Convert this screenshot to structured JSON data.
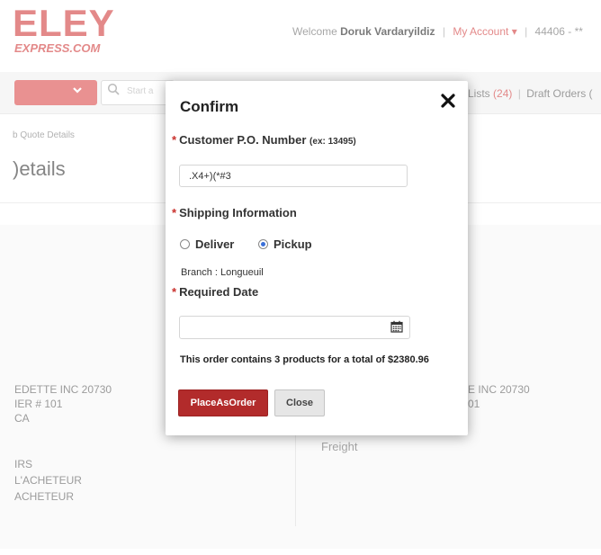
{
  "header": {
    "logo_main": "ELEY",
    "logo_sub": "EXPRESS.COM",
    "welcome_prefix": "Welcome",
    "user_name": "Doruk Vardaryildiz",
    "my_account_label": "My Account",
    "account_number": "44406 - **"
  },
  "navbar": {
    "search_placeholder": "Start a",
    "lists_label": "Lists",
    "lists_count": "(24)",
    "draft_orders_label": "Draft Orders ("
  },
  "page": {
    "breadcrumb": "b Quote Details",
    "title": ")etails",
    "left_address": [
      "EDETTE INC 20730",
      "IER # 101",
      "CA"
    ],
    "left_notes": [
      "IRS",
      "L'ACHETEUR",
      "ACHETEUR"
    ],
    "right_address": [
      "E INC 20730",
      "01"
    ],
    "freight_label": "Freight"
  },
  "modal": {
    "title": "Confirm",
    "close_glyph": "✕",
    "po_label": "Customer P.O. Number",
    "po_hint": "(ex: 13495)",
    "po_value": ".X4+)(*#3",
    "shipping_label": "Shipping Information",
    "deliver_label": "Deliver",
    "pickup_label": "Pickup",
    "selected_shipping": "pickup",
    "branch_text": "Branch : Longueuil",
    "required_date_label": "Required Date",
    "required_date_value": "",
    "summary": "This order contains 3 products for a total of $2380.96",
    "place_order_label": "PlaceAsOrder",
    "close_label": "Close"
  },
  "colors": {
    "brand_red": "#d44a4a",
    "primary_button": "#b22b2b",
    "radio_selected": "#3a6fd8"
  }
}
